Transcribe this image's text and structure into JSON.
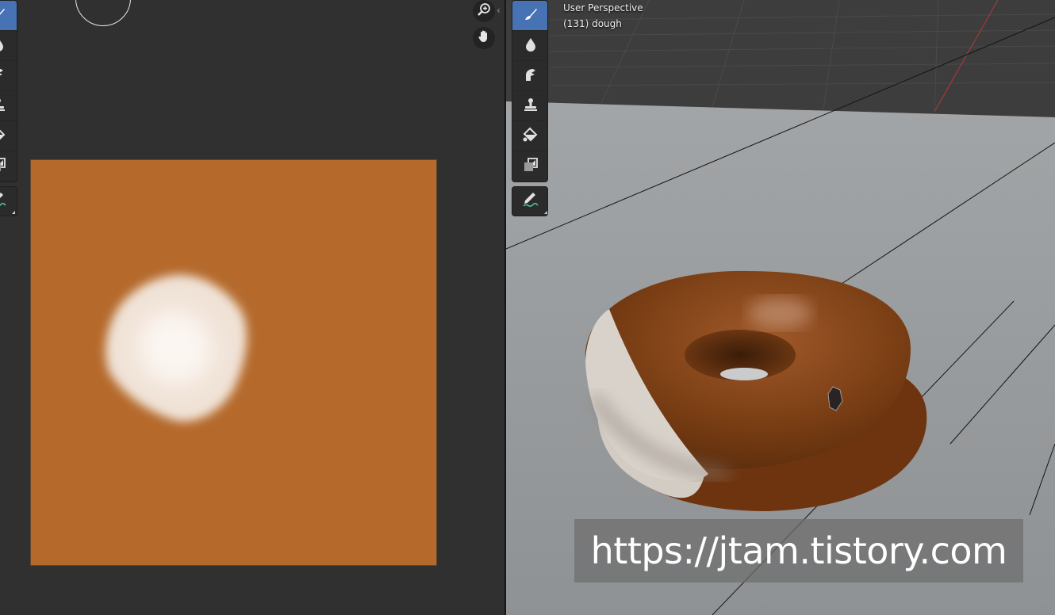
{
  "image_editor": {
    "canvas_color": "#b56a2c",
    "paint_blob_color": "#f3e8df",
    "navigation": {
      "zoom_icon": "zoom-in-icon",
      "pan_icon": "hand-icon"
    },
    "sidebar_toggle": "‹",
    "tools": [
      {
        "name": "draw-brush-icon",
        "active": true
      },
      {
        "name": "soften-drop-icon",
        "active": false
      },
      {
        "name": "smear-icon",
        "active": false
      },
      {
        "name": "clone-stamp-icon",
        "active": false
      },
      {
        "name": "fill-bucket-icon",
        "active": false
      },
      {
        "name": "mask-icon",
        "active": false
      }
    ],
    "annotate_tool": {
      "name": "annotate-pencil-icon"
    }
  },
  "viewport": {
    "info": {
      "view": "User Perspective",
      "object": "(131) dough"
    },
    "colors": {
      "dough_brown": "#7a3e14",
      "dough_cream": "#d8d2cb",
      "floor": "#979a9c",
      "grid_dark": "#3d3d3d"
    },
    "tools": [
      {
        "name": "draw-brush-icon",
        "active": true
      },
      {
        "name": "soften-drop-icon",
        "active": false
      },
      {
        "name": "smear-icon",
        "active": false
      },
      {
        "name": "clone-stamp-icon",
        "active": false
      },
      {
        "name": "fill-bucket-icon",
        "active": false
      },
      {
        "name": "mask-icon",
        "active": false
      }
    ],
    "annotate_tool": {
      "name": "annotate-pencil-icon"
    }
  },
  "watermark": {
    "text": "https://jtam.tistory.com"
  }
}
